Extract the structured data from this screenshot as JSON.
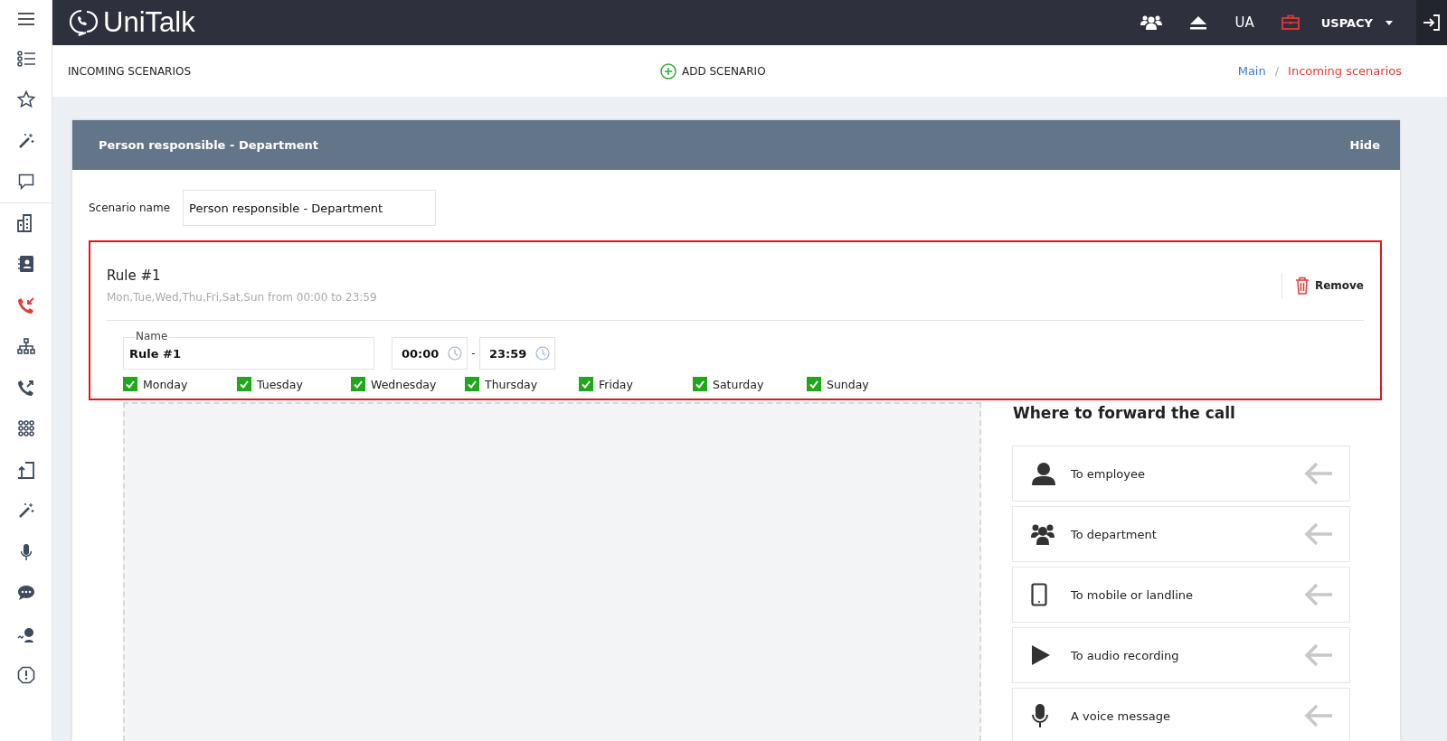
{
  "sidebar": {
    "items": [
      {
        "kind": "menu",
        "selected": false
      },
      {
        "kind": "list",
        "selected": false
      },
      {
        "kind": "star",
        "selected": false
      },
      {
        "kind": "wand",
        "selected": false
      },
      {
        "kind": "chat",
        "selected": false
      },
      {
        "kind": "building",
        "selected": false
      },
      {
        "kind": "contacts",
        "selected": false
      },
      {
        "kind": "incoming",
        "selected": true
      },
      {
        "kind": "tree",
        "selected": false
      },
      {
        "kind": "outgoing",
        "selected": false
      },
      {
        "kind": "grid",
        "selected": false
      },
      {
        "kind": "transfer",
        "selected": false
      },
      {
        "kind": "wand",
        "selected": false
      },
      {
        "kind": "mic",
        "selected": false
      },
      {
        "kind": "bubble",
        "selected": false
      },
      {
        "kind": "agent",
        "selected": false
      },
      {
        "kind": "alert",
        "selected": false
      }
    ]
  },
  "topbar": {
    "logo": "UniTalk",
    "language": "UA",
    "company": "USPACY"
  },
  "header": {
    "title": "INCOMING SCENARIOS",
    "add_button": "ADD SCENARIO",
    "breadcrumb_separator": "/",
    "breadcrumbs": [
      {
        "label": "Main",
        "current": false
      },
      {
        "label": "Incoming scenarios",
        "current": true
      }
    ]
  },
  "card": {
    "title": "Person responsible - Department",
    "hide": "Hide",
    "scenario_label": "Scenario name",
    "scenario_value": "Person responsible - Department"
  },
  "rule": {
    "title": "Rule #1",
    "summary": "Mon,Tue,Wed,Thu,Fri,Sat,Sun from 00:00 to 23:59",
    "remove": "Remove",
    "name_label": "Name",
    "name_value": "Rule #1",
    "time_from": "00:00",
    "separator": "-",
    "time_to": "23:59",
    "days": [
      {
        "label": "Monday",
        "checked": true
      },
      {
        "label": "Tuesday",
        "checked": true
      },
      {
        "label": "Wednesday",
        "checked": true
      },
      {
        "label": "Thursday",
        "checked": true
      },
      {
        "label": "Friday",
        "checked": true
      },
      {
        "label": "Saturday",
        "checked": true
      },
      {
        "label": "Sunday",
        "checked": true
      }
    ]
  },
  "forward": {
    "title": "Where to forward the call",
    "options": [
      {
        "kind": "employee",
        "label": "To employee"
      },
      {
        "kind": "department",
        "label": "To department"
      },
      {
        "kind": "phone",
        "label": "To mobile or landline"
      },
      {
        "kind": "play",
        "label": "To audio recording"
      },
      {
        "kind": "mic",
        "label": "A voice message"
      }
    ]
  }
}
